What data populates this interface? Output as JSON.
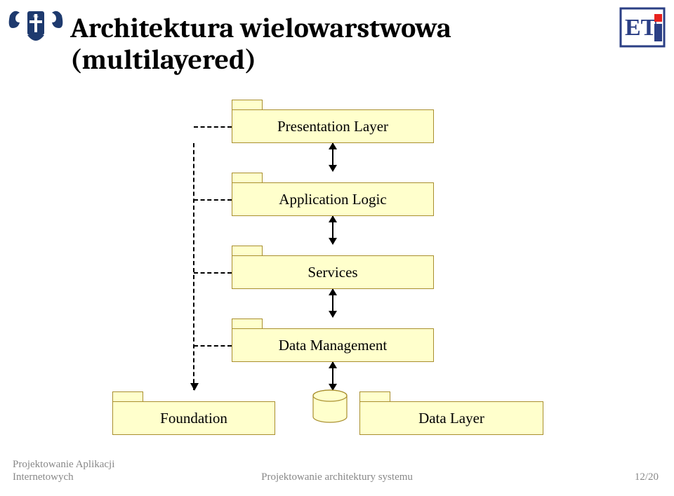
{
  "title_line1": "Architektura wielowarstwowa",
  "title_line2": "(multilayered)",
  "layers": {
    "presentation": "Presentation Layer",
    "application": "Application Logic",
    "services": "Services",
    "dataManagement": "Data Management",
    "foundation": "Foundation",
    "dataLayer": "Data Layer"
  },
  "footer": {
    "left_line1": "Projektowanie Aplikacji",
    "left_line2": "Internetowych",
    "center": "Projektowanie architektury systemu",
    "right": "12/20"
  },
  "colors": {
    "package_fill": "#FFFFCC",
    "package_border": "#A98F2E"
  }
}
